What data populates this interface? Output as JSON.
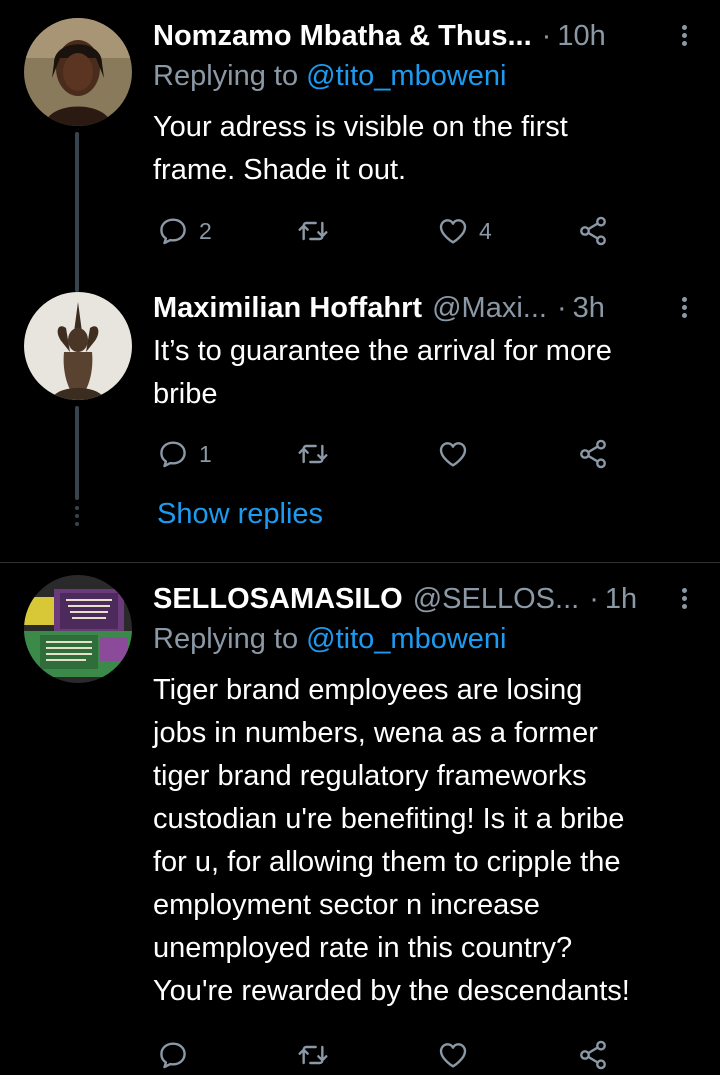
{
  "tweets": [
    {
      "name": "Nomzamo Mbatha & Thus...",
      "handle": "",
      "separator": "·",
      "time": "10h",
      "replying_label": "Replying to",
      "replying_to": "@tito_mboweni",
      "text_lines": [
        "Your adress is visible on the first",
        "frame. Shade it out."
      ],
      "reply_count": "2",
      "retweet_count": "",
      "like_count": "4"
    },
    {
      "name": "Maximilian Hoffahrt",
      "handle": "@Maxi...",
      "separator": "·",
      "time": "3h",
      "text_lines": [
        "It’s to guarantee the arrival for more",
        "bribe"
      ],
      "reply_count": "1",
      "retweet_count": "",
      "like_count": ""
    },
    {
      "name": "SELLOSAMASILO",
      "handle": "@SELLOS...",
      "separator": "·",
      "time": "1h",
      "replying_label": "Replying to",
      "replying_to": "@tito_mboweni",
      "text_lines": [
        "Tiger brand employees are losing",
        "jobs in numbers, wena as a former",
        "tiger brand regulatory frameworks",
        "custodian u're benefiting! Is it a bribe",
        "for u, for allowing them to cripple the",
        "employment sector n increase",
        "unemployed rate in this country?",
        "You're rewarded by the descendants!"
      ]
    }
  ],
  "show_replies_label": "Show replies",
  "icons": [
    "reply-icon",
    "retweet-icon",
    "like-icon",
    "share-icon",
    "more-icon"
  ],
  "colors": {
    "background": "#000000",
    "text": "#ffffff",
    "muted": "#8b98a5",
    "accent": "#1d9bf0",
    "divider": "#2f3336"
  }
}
